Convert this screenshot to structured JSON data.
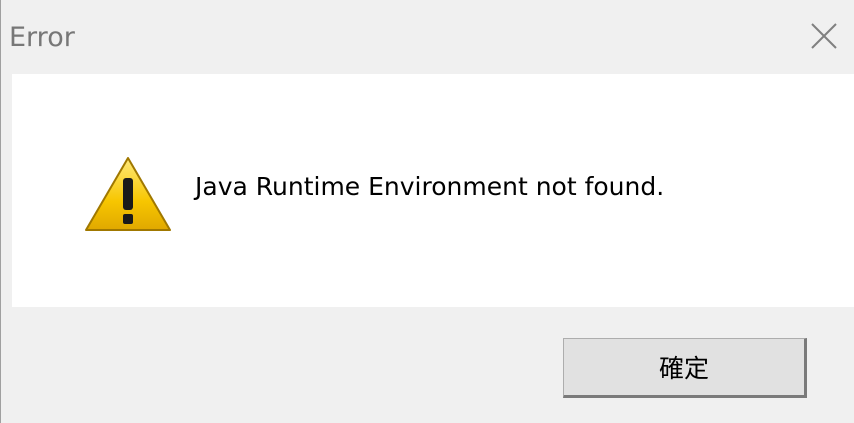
{
  "dialog": {
    "title": "Error",
    "message": "Java Runtime Environment not found.",
    "ok_label": "確定",
    "icon": "warning-icon",
    "close_icon": "close-icon"
  },
  "colors": {
    "title_bar": "#f0f0f0",
    "content_background": "#ffffff",
    "button_background": "#e1e1e1",
    "warning_yellow": "#f5c400"
  }
}
